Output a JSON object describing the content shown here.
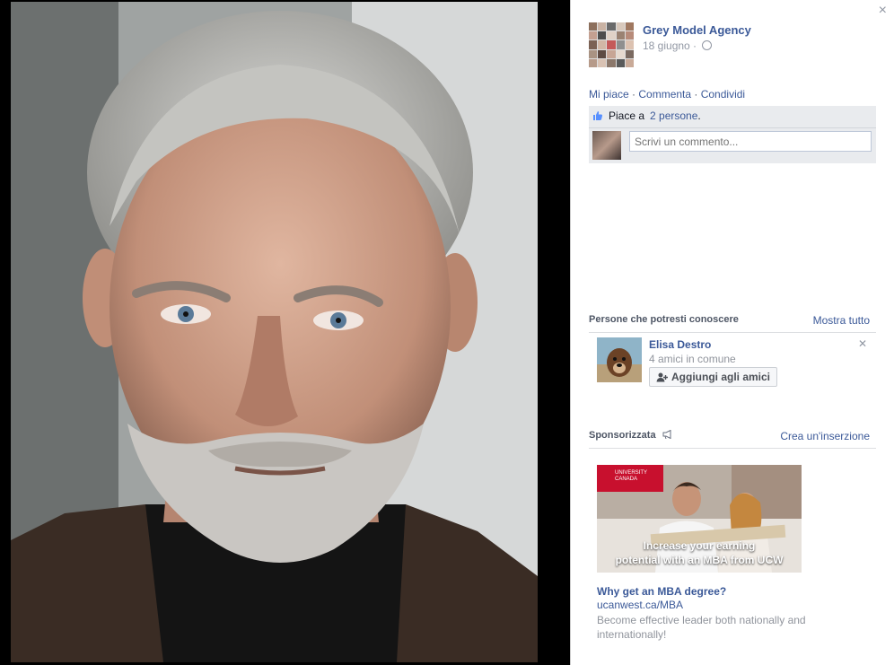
{
  "page": {
    "name": "Grey Model Agency",
    "date": "18 giugno ·"
  },
  "actions": {
    "like": "Mi piace",
    "sep1": " · ",
    "comment": "Commenta",
    "sep2": " · ",
    "share": "Condividi"
  },
  "likes": {
    "prefix": "Piace a",
    "count_link": "2 persone",
    "suffix": "."
  },
  "comment": {
    "placeholder": "Scrivi un commento..."
  },
  "people_you_may_know": {
    "title": "Persone che potresti conoscere",
    "see_all": "Mostra tutto",
    "person": {
      "name": "Elisa Destro",
      "mutual": "4 amici in comune",
      "add_button": "Aggiungi agli amici"
    }
  },
  "sponsored": {
    "title": "Sponsorizzata",
    "create_ad": "Crea un'inserzione",
    "ad": {
      "logo_text_line1": "UNIVERSITY",
      "logo_text_line2": "CANADA",
      "image_caption_line1": "Increase your earning",
      "image_caption_line2": "potential with an MBA from UCW",
      "headline": "Why get an MBA degree?",
      "url": "ucanwest.ca/MBA",
      "body": "Become effective leader both nationally and internationally!"
    }
  },
  "colors": {
    "link": "#3b5998",
    "muted": "#90949c",
    "ad_brand": "#c8102e"
  },
  "icons": [
    "close-icon",
    "globe-icon",
    "thumbs-up-icon",
    "add-friend-icon",
    "megaphone-icon"
  ]
}
